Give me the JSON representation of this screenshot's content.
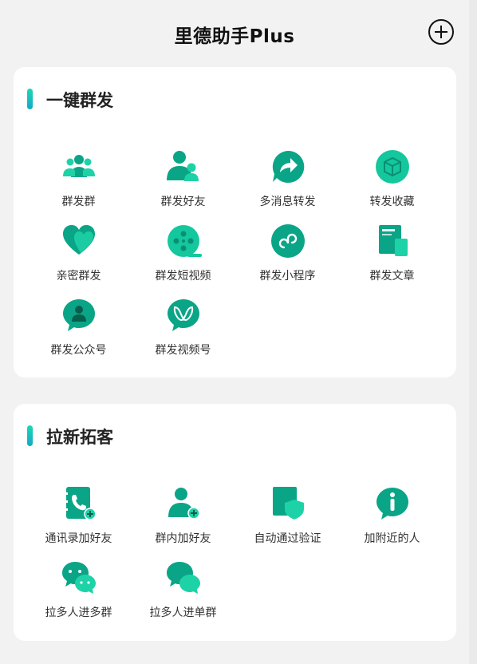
{
  "app": {
    "title": "里德助手Plus",
    "add_icon": "plus-circle-icon"
  },
  "colors": {
    "accent": "#1ed2a8",
    "accent_dark": "#0aa586",
    "card_bg": "#ffffff",
    "page_bg": "#f2f2f2"
  },
  "broadcast": {
    "title": "一键群发",
    "items": [
      {
        "label": "群发群",
        "icon": "group-icon"
      },
      {
        "label": "群发好友",
        "icon": "friends-icon"
      },
      {
        "label": "多消息转发",
        "icon": "forward-icon"
      },
      {
        "label": "转发收藏",
        "icon": "box-icon"
      },
      {
        "label": "亲密群发",
        "icon": "heart-icon"
      },
      {
        "label": "群发短视频",
        "icon": "film-reel-icon"
      },
      {
        "label": "群发小程序",
        "icon": "mini-program-icon"
      },
      {
        "label": "群发文章",
        "icon": "article-icon"
      },
      {
        "label": "群发公众号",
        "icon": "official-account-icon"
      },
      {
        "label": "群发视频号",
        "icon": "video-channel-icon"
      }
    ]
  },
  "acquire": {
    "title": "拉新拓客",
    "items": [
      {
        "label": "通讯录加好友",
        "icon": "contacts-book-icon"
      },
      {
        "label": "群内加好友",
        "icon": "add-person-icon"
      },
      {
        "label": "自动通过验证",
        "icon": "shield-verify-icon"
      },
      {
        "label": "加附近的人",
        "icon": "location-pin-icon"
      },
      {
        "label": "拉多人进多群",
        "icon": "multi-chat-icon"
      },
      {
        "label": "拉多人进单群",
        "icon": "chat-bubbles-icon"
      }
    ]
  }
}
